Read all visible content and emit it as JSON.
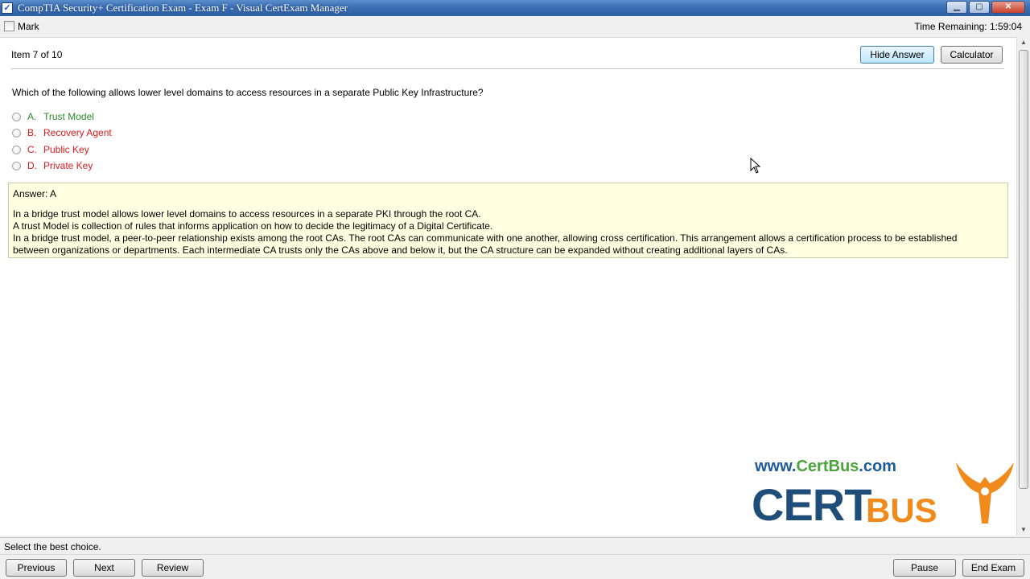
{
  "window": {
    "title": "CompTIA Security+ Certification Exam - Exam F - Visual CertExam Manager",
    "app_icon": "checkmark",
    "controls": {
      "minimize": "minimize-icon",
      "maximize": "maximize-icon",
      "close": "close-icon"
    }
  },
  "topbar": {
    "mark_label": "Mark",
    "mark_checked": false,
    "time_remaining": "Time Remaining: 1:59:04"
  },
  "header": {
    "item_counter": "Item 7 of 10",
    "hide_answer_label": "Hide Answer",
    "calculator_label": "Calculator"
  },
  "question": {
    "text": "Which of the following allows lower level domains to access resources in a separate Public Key Infrastructure?",
    "choices": [
      {
        "letter": "A.",
        "text": "Trust Model",
        "status": "correct"
      },
      {
        "letter": "B.",
        "text": "Recovery Agent",
        "status": "incorrect"
      },
      {
        "letter": "C.",
        "text": "Public Key",
        "status": "incorrect"
      },
      {
        "letter": "D.",
        "text": "Private Key",
        "status": "incorrect"
      }
    ]
  },
  "answer": {
    "title": "Answer: A",
    "lines": [
      "In a bridge trust model allows lower level domains to access resources in a separate PKI through the root CA.",
      "A trust Model is collection of rules that informs application on how to decide the legitimacy of a Digital Certificate.",
      "In a bridge trust model, a peer-to-peer relationship exists among the root CAs. The root CAs can communicate with one another, allowing cross certification. This arrangement allows a certification process to be established",
      "between organizations or departments. Each intermediate CA trusts only the CAs above and below it, but the CA structure can be expanded without creating additional layers of CAs."
    ]
  },
  "watermark": {
    "url_prefix": "www.",
    "url_mid": "CertBus",
    "url_suffix": ".com",
    "brand_cert": "CERT",
    "brand_bus": "BUS"
  },
  "status": {
    "text": "Select the best choice."
  },
  "nav": {
    "previous": "Previous",
    "next": "Next",
    "review": "Review",
    "pause": "Pause",
    "end_exam": "End Exam"
  },
  "colors": {
    "correct": "#2e8b2e",
    "incorrect": "#e01b1b",
    "answer_bg": "#ffffe1",
    "titlebar": "#3b6fb4"
  }
}
